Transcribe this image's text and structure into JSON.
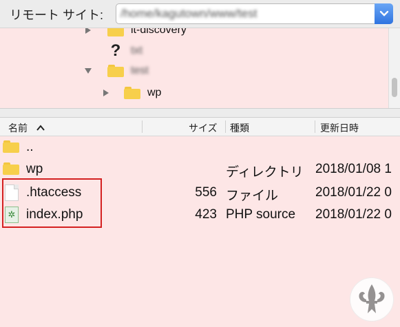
{
  "pathbar": {
    "label": "リモート サイト:",
    "path_value": "/home/kagutown/www/test"
  },
  "tree": {
    "rows": [
      {
        "name": "it-discovery"
      },
      {
        "name": "txt"
      },
      {
        "name": "test"
      },
      {
        "name": "wp"
      }
    ]
  },
  "columns": {
    "name": "名前",
    "size": "サイズ",
    "type": "種類",
    "modified": "更新日時"
  },
  "files": [
    {
      "name": "..",
      "size": "",
      "type": "",
      "modified": ""
    },
    {
      "name": "wp",
      "size": "",
      "type": "ディレクトリ",
      "modified": "2018/01/08 1"
    },
    {
      "name": ".htaccess",
      "size": "556",
      "type": "ファイル",
      "modified": "2018/01/22 0"
    },
    {
      "name": "index.php",
      "size": "423",
      "type": "PHP source",
      "modified": "2018/01/22 0"
    }
  ],
  "colors": {
    "pane_bg": "#fde6e6",
    "highlight": "#d42020",
    "accent": "#2f74e0",
    "folder": "#f7cf4b"
  },
  "icons": {
    "folder": "folder-icon",
    "file": "file-icon",
    "php": "php-file-icon",
    "unknown": "unknown-file-icon"
  }
}
